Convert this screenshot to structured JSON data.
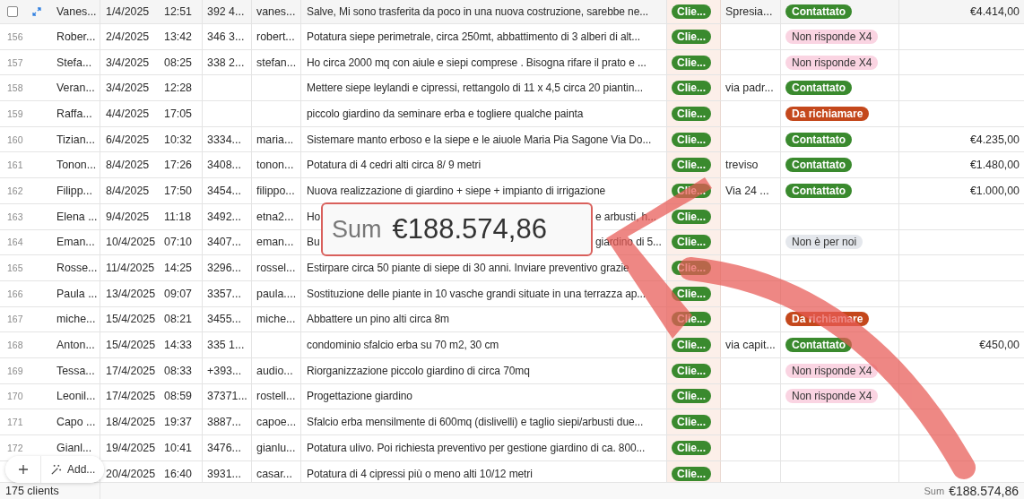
{
  "table": {
    "rows": [
      {
        "hovered": true,
        "name": "Vanes...",
        "date": "1/4/2025",
        "time": "12:51",
        "phone": "392 4...",
        "email": "vanes...",
        "description": "Salve, Mi sono trasferita da poco in una nuova costruzione, sarebbe ne...",
        "type": {
          "label": "Clie...",
          "color": "#3a8a2e"
        },
        "address": "Spresia...",
        "status": {
          "label": "Contattato",
          "color": "#3a8a2e"
        },
        "amount": "€4.414,00"
      },
      {
        "hovered": false,
        "row_number": "156",
        "name": "Rober...",
        "date": "2/4/2025",
        "time": "13:42",
        "phone": "346 3...",
        "email": "robert...",
        "description": "Potatura siepe perimetrale, circa 250mt, abbattimento di 3 alberi di alt...",
        "type": {
          "label": "Clie...",
          "color": "#3a8a2e"
        },
        "status": {
          "label": "Non risponde X4",
          "color": "#fad4e2"
        }
      },
      {
        "hovered": false,
        "row_number": "157",
        "name": "Stefa...",
        "date": "3/4/2025",
        "time": "08:25",
        "phone": "338 2...",
        "email": "stefan...",
        "description": "Ho circa 2000 mq con aiule e siepi comprese . Bisogna rifare il prato e ...",
        "type": {
          "label": "Clie...",
          "color": "#3a8a2e"
        },
        "status": {
          "label": "Non risponde X4",
          "color": "#fad4e2"
        }
      },
      {
        "hovered": false,
        "row_number": "158",
        "name": "Veran...",
        "date": "3/4/2025",
        "time": "12:28",
        "description": "Mettere siepe leylandi e cipressi, rettangolo di 11 x 4,5 circa 20 piantin...",
        "type": {
          "label": "Clie...",
          "color": "#3a8a2e"
        },
        "address": "via padr...",
        "status": {
          "label": "Contattato",
          "color": "#3a8a2e"
        }
      },
      {
        "hovered": false,
        "row_number": "159",
        "name": "Raffa...",
        "date": "4/4/2025",
        "time": "17:05",
        "description": "piccolo giardino da seminare erba e togliere qualche painta",
        "type": {
          "label": "Clie...",
          "color": "#3a8a2e"
        },
        "status": {
          "label": "Da richiamare",
          "color": "#c4481c"
        }
      },
      {
        "hovered": false,
        "row_number": "160",
        "name": "Tizian...",
        "date": "6/4/2025",
        "time": "10:32",
        "phone": "3334...",
        "email": "maria...",
        "description": "Sistemare manto erboso e la siepe e le aiuole Maria Pia Sagone Via Do...",
        "type": {
          "label": "Clie...",
          "color": "#3a8a2e"
        },
        "status": {
          "label": "Contattato",
          "color": "#3a8a2e"
        },
        "amount": "€4.235,00"
      },
      {
        "hovered": false,
        "row_number": "161",
        "name": "Tonon...",
        "date": "8/4/2025",
        "time": "17:26",
        "phone": "3408...",
        "email": "tonon...",
        "description": "Potatura di 4 cedri alti circa 8/ 9 metri",
        "type": {
          "label": "Clie...",
          "color": "#3a8a2e"
        },
        "address": "treviso",
        "status": {
          "label": "Contattato",
          "color": "#3a8a2e"
        },
        "amount": "€1.480,00"
      },
      {
        "hovered": false,
        "row_number": "162",
        "name": "Filipp...",
        "date": "8/4/2025",
        "time": "17:50",
        "phone": "3454...",
        "email": "filippo...",
        "description": "Nuova realizzazione di giardino + siepe + impianto di irrigazione",
        "type": {
          "label": "Clie...",
          "color": "#3a8a2e"
        },
        "address": "Via 24 ...",
        "status": {
          "label": "Contattato",
          "color": "#3a8a2e"
        },
        "amount": "€1.000,00"
      },
      {
        "hovered": false,
        "row_number": "163",
        "name": "Elena ...",
        "date": "9/4/2025",
        "time": "11:18",
        "phone": "3492...",
        "email": "etna2...",
        "description_parts": [
          "Ho",
          "e arbusti, h..."
        ],
        "type": {
          "label": "Clie...",
          "color": "#3a8a2e"
        }
      },
      {
        "hovered": false,
        "row_number": "164",
        "name": "Eman...",
        "date": "10/4/2025",
        "time": "07:10",
        "phone": "3407...",
        "email": "eman...",
        "description_parts": [
          "Bu",
          "giardino di 5..."
        ],
        "type": {
          "label": "Clie...",
          "color": "#3a8a2e"
        },
        "status": {
          "label": "Non è per noi",
          "color": "#e4e7ec"
        }
      },
      {
        "hovered": false,
        "row_number": "165",
        "name": "Rosse...",
        "date": "11/4/2025",
        "time": "14:25",
        "phone": "3296...",
        "email": "rossel...",
        "description": "Estirpare circa 50 piante di siepe di 30 anni. Inviare preventivo grazie",
        "type": {
          "label": "Clie...",
          "color": "#3a8a2e"
        }
      },
      {
        "hovered": false,
        "row_number": "166",
        "name": "Paula ...",
        "date": "13/4/2025",
        "time": "09:07",
        "phone": "3357...",
        "email": "paula....",
        "description": "Sostituzione delle piante in 10 vasche grandi situate in una terrazza ap...",
        "type": {
          "label": "Clie...",
          "color": "#3a8a2e"
        }
      },
      {
        "hovered": false,
        "row_number": "167",
        "name": "miche...",
        "date": "15/4/2025",
        "time": "08:21",
        "phone": "3455...",
        "email": "miche...",
        "description": "Abbattere un pino alti circa 8m",
        "type": {
          "label": "Clie...",
          "color": "#3a8a2e"
        },
        "status": {
          "label": "Da richiamare",
          "color": "#c4481c"
        }
      },
      {
        "hovered": false,
        "row_number": "168",
        "name": "Anton...",
        "date": "15/4/2025",
        "time": "14:33",
        "phone": "335 1...",
        "description": "condominio sfalcio erba su 70 m2, 30 cm",
        "type": {
          "label": "Clie...",
          "color": "#3a8a2e"
        },
        "address": "via capit...",
        "status": {
          "label": "Contattato",
          "color": "#3a8a2e"
        },
        "amount": "€450,00"
      },
      {
        "hovered": false,
        "row_number": "169",
        "name": "Tessa...",
        "date": "17/4/2025",
        "time": "08:33",
        "phone": "+393...",
        "email": "audio...",
        "description": "Riorganizzazione piccolo giardino di circa 70mq",
        "type": {
          "label": "Clie...",
          "color": "#3a8a2e"
        },
        "status": {
          "label": "Non risponde X4",
          "color": "#fad4e2"
        }
      },
      {
        "hovered": false,
        "row_number": "170",
        "name": "Leonil...",
        "date": "17/4/2025",
        "time": "08:59",
        "phone": "37371...",
        "email": "rostell...",
        "description": "Progettazione giardino",
        "type": {
          "label": "Clie...",
          "color": "#3a8a2e"
        },
        "status": {
          "label": "Non risponde X4",
          "color": "#fad4e2"
        }
      },
      {
        "hovered": false,
        "row_number": "171",
        "name": "Capo ...",
        "date": "18/4/2025",
        "time": "19:37",
        "phone": "3887...",
        "email": "capoe...",
        "description": "Sfalcio erba mensilmente di 600mq (dislivelli) e taglio siepi/arbusti due...",
        "type": {
          "label": "Clie...",
          "color": "#3a8a2e"
        }
      },
      {
        "hovered": false,
        "row_number": "172",
        "name": "Gianl...",
        "date": "19/4/2025",
        "time": "10:41",
        "phone": "3476...",
        "email": "gianlu...",
        "description": "Potatura ulivo. Poi richiesta preventivo per gestione giardino di ca. 800...",
        "type": {
          "label": "Clie...",
          "color": "#3a8a2e"
        }
      },
      {
        "hovered": false,
        "date": "20/4/2025",
        "time": "16:40",
        "phone": "3931...",
        "email": "casar...",
        "description": "Potatura di 4 cipressi più o meno alti 10/12 metri",
        "type": {
          "label": "Clie...",
          "color": "#3a8a2e"
        }
      }
    ]
  },
  "add_bar": {
    "add_label": "Add..."
  },
  "footer": {
    "record_count": "175 clients",
    "sum_label": "Sum",
    "sum_value": "€188.574,86"
  },
  "annotation": {
    "sum_label": "Sum",
    "sum_value": "€188.574,86"
  }
}
